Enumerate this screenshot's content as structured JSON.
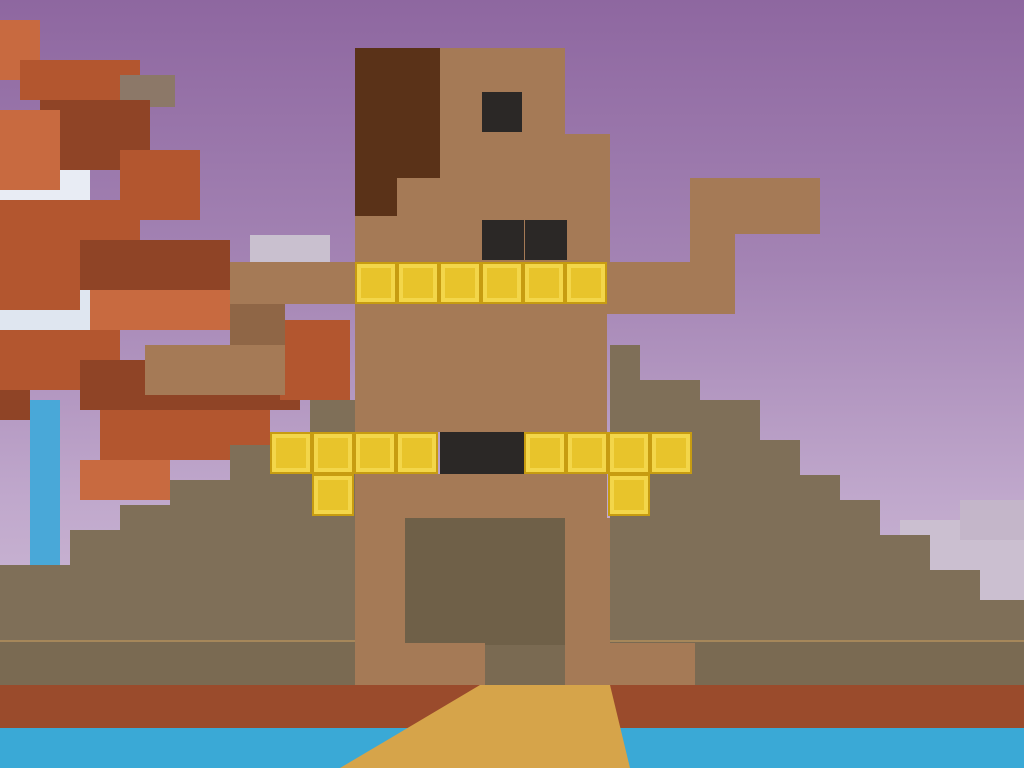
{
  "colors": {
    "sky_top": "#8e67a0",
    "sky_bottom": "#d7c8dc",
    "tree_leaves": "#b3562f",
    "pyramid_stone": "#7f6f58",
    "statue_wood": "#a57a56",
    "statue_bark": "#5a3218",
    "gold_block": "#e8c42b",
    "obsidian_block": "#2b2826",
    "water": "#3aa9d6",
    "red_sand": "#9a4b2c",
    "path_sand": "#d6a44a"
  },
  "scene": {
    "statue": "block-figure-statue",
    "pyramid": "stepped-stone-pyramid",
    "tree": "autumn-leaf-tree",
    "waterfall": "waterfall",
    "ground": "water-and-sand-shore"
  }
}
